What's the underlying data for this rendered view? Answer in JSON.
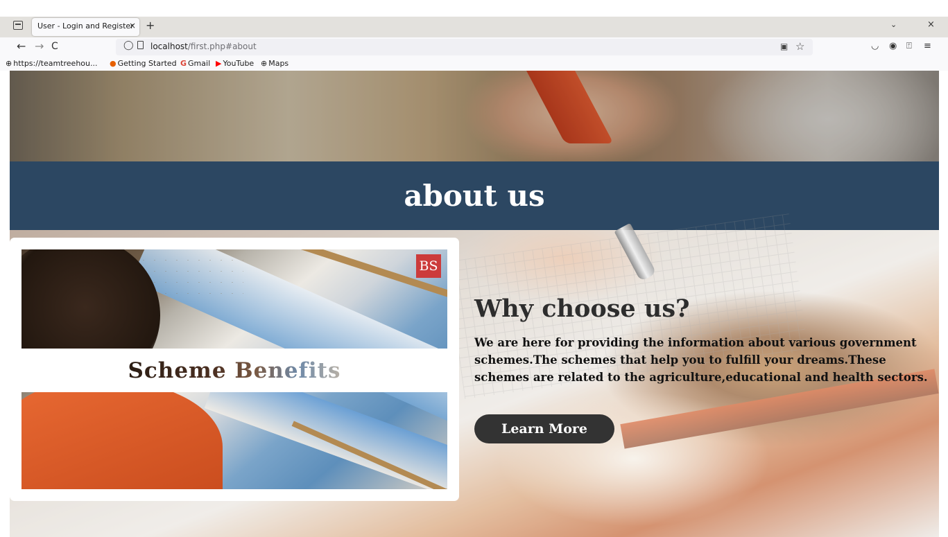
{
  "browser": {
    "tab_title": "User - Login and Register",
    "tab_close": "×",
    "new_tab": "+",
    "tab_overflow": "⌄",
    "window_close": "×",
    "nav": {
      "back": "←",
      "forward": "→",
      "reload": "C"
    },
    "url": {
      "host": "localhost",
      "path": "/first.php#about"
    },
    "bookmarks": [
      {
        "label": "https://teamtreehou...",
        "icon": "globe-icon"
      },
      {
        "label": "Getting Started",
        "icon": "firefox-icon"
      },
      {
        "label": "Gmail",
        "icon": "google-icon"
      },
      {
        "label": "YouTube",
        "icon": "youtube-icon"
      },
      {
        "label": "Maps",
        "icon": "globe-icon"
      }
    ],
    "right_icons": [
      "pocket-icon",
      "account-icon",
      "extensions-icon",
      "menu-icon"
    ]
  },
  "page": {
    "about_title": "about us",
    "card": {
      "image_title": "Scheme Benefits",
      "logo_text": "BS"
    },
    "why": {
      "title": "Why choose us?",
      "text": "We are here for providing the information about various government schemes.The schemes that help you to fulfill your dreams.These schemes are related to the agriculture,educational and health sectors.",
      "button_label": "Learn More"
    }
  },
  "colors": {
    "banner": "#2c4762",
    "button": "#333333",
    "card": "#ffffff",
    "logo": "#cc3b3b"
  }
}
